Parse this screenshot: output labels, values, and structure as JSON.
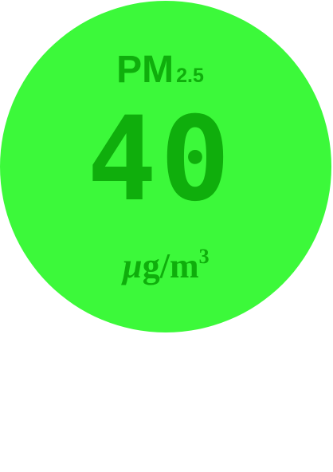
{
  "gauge": {
    "color": "#3cf93a",
    "text_color": "#0fae0c",
    "label_main": "PM",
    "label_sub": "2.5",
    "value": "40",
    "unit_prefix": "µ",
    "unit_main": "g/m",
    "unit_exponent": "3"
  }
}
